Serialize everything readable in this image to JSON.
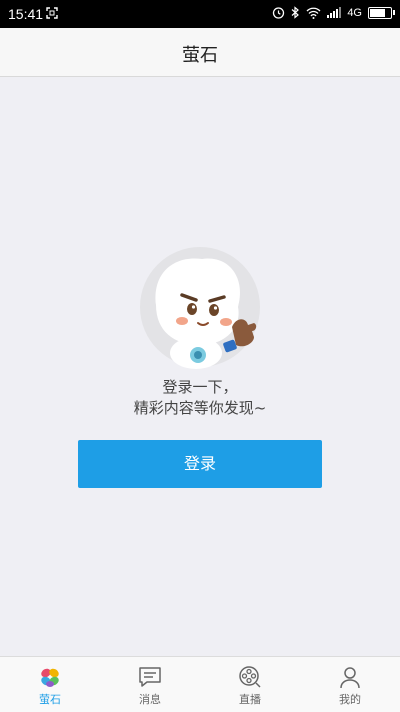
{
  "status_bar": {
    "time": "15:41",
    "network": "4G",
    "battery_level": 0.9,
    "icons": [
      "screenshot-icon",
      "alarm-icon",
      "bluetooth-icon",
      "wifi-icon",
      "signal-icon",
      "battery-icon"
    ]
  },
  "nav": {
    "title": "萤石"
  },
  "empty_state": {
    "line1": "登录一下，",
    "line2": "精彩内容等你发现~",
    "login_label": "登录"
  },
  "tabs": [
    {
      "label": "萤石",
      "icon": "ezviz-logo-icon",
      "active": true
    },
    {
      "label": "消息",
      "icon": "message-icon",
      "active": false
    },
    {
      "label": "直播",
      "icon": "live-icon",
      "active": false
    },
    {
      "label": "我的",
      "icon": "profile-icon",
      "active": false
    }
  ],
  "colors": {
    "accent": "#1e9ee6",
    "background": "#efeff4",
    "tab_inactive": "#666666"
  }
}
